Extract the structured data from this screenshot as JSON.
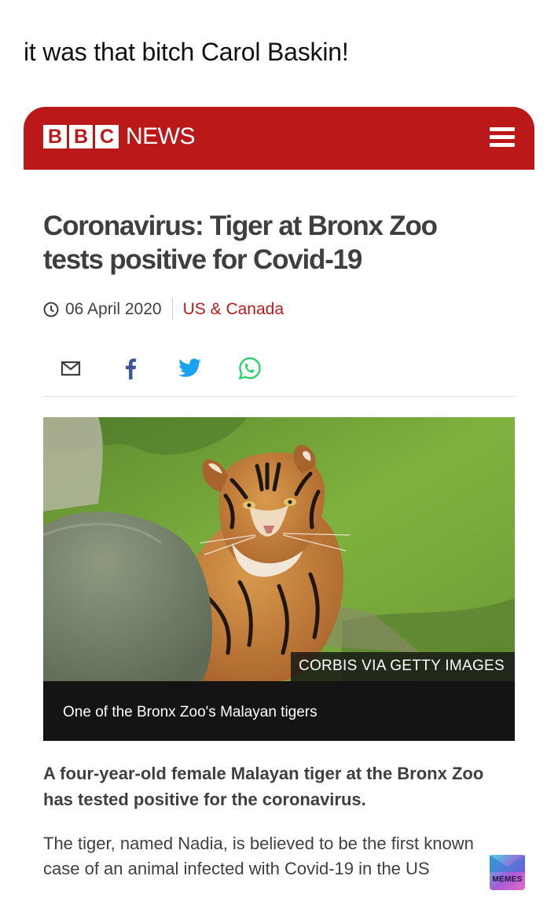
{
  "meme": {
    "caption": "it was that bitch Carol Baskin!"
  },
  "header": {
    "logo_letters": [
      "B",
      "B",
      "C"
    ],
    "logo_text": "NEWS",
    "brand_color": "#bb1919"
  },
  "article": {
    "headline": "Coronavirus: Tiger at Bronx Zoo tests positive for Covid-19",
    "date": "06 April 2020",
    "section": "US & Canada",
    "share_icons": [
      "email-icon",
      "facebook-icon",
      "twitter-icon",
      "whatsapp-icon"
    ],
    "image": {
      "credit": "CORBIS VIA GETTY IMAGES",
      "caption": "One of the Bronx Zoo's Malayan tigers"
    },
    "intro": "A four-year-old female Malayan tiger at the Bronx Zoo has tested positive for the coronavirus.",
    "body": "The tiger, named Nadia, is believed to be the first known case of an animal infected with Covid-19 in the US"
  },
  "watermark": {
    "label": "MEMES"
  }
}
